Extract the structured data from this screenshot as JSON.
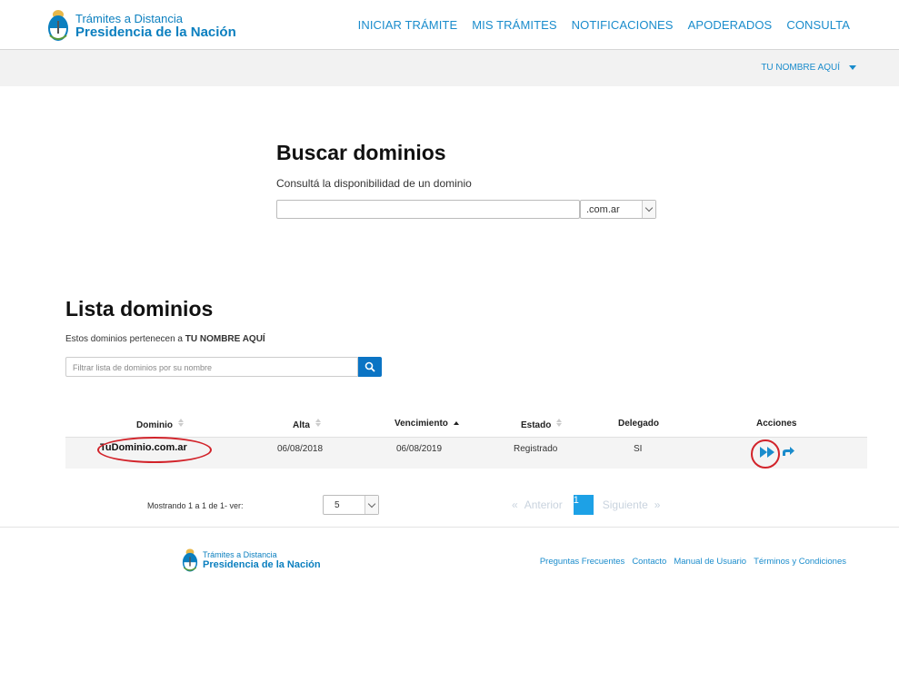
{
  "brand": {
    "line1": "Trámites a Distancia",
    "line2": "Presidencia de la Nación",
    "accent_color": "#0b7fbf"
  },
  "nav": {
    "items": [
      "INICIAR TRÁMITE",
      "MIS TRÁMITES",
      "NOTIFICACIONES",
      "APODERADOS",
      "CONSULTA"
    ]
  },
  "user_menu": {
    "label": "TU NOMBRE AQUÍ"
  },
  "buscar": {
    "title": "Buscar dominios",
    "subtitle": "Consultá la disponibilidad de un dominio",
    "input_value": "",
    "tld_selected": ".com.ar"
  },
  "lista": {
    "title": "Lista dominios",
    "owner_prefix": "Estos dominios pertenecen a",
    "owner_name": "TU NOMBRE AQUÍ",
    "filter_placeholder": "Filtrar lista de dominios por su nombre"
  },
  "table": {
    "columns": [
      "Dominio",
      "Alta",
      "Vencimiento",
      "Estado",
      "Delegado",
      "Acciones"
    ],
    "rows": [
      {
        "dominio": "TuDominio.com.ar",
        "alta": "06/08/2018",
        "vencimiento": "06/08/2019",
        "estado": "Registrado",
        "delegado": "SI"
      }
    ]
  },
  "pagination": {
    "showing": "Mostrando 1 a 1 de 1- ver:",
    "page_size": "5",
    "prev_arrow": "«",
    "prev": "Anterior",
    "current_page": "1",
    "next": "Siguiente",
    "next_arrow": "»"
  },
  "footer": {
    "links": [
      "Preguntas Frecuentes",
      "Contacto",
      "Manual de Usuario",
      "Términos y Condiciones"
    ]
  },
  "colors": {
    "link": "#1a8ccc",
    "primary_button": "#0b74c4",
    "page_active": "#1da1e6",
    "highlight_red": "#d2232a"
  }
}
